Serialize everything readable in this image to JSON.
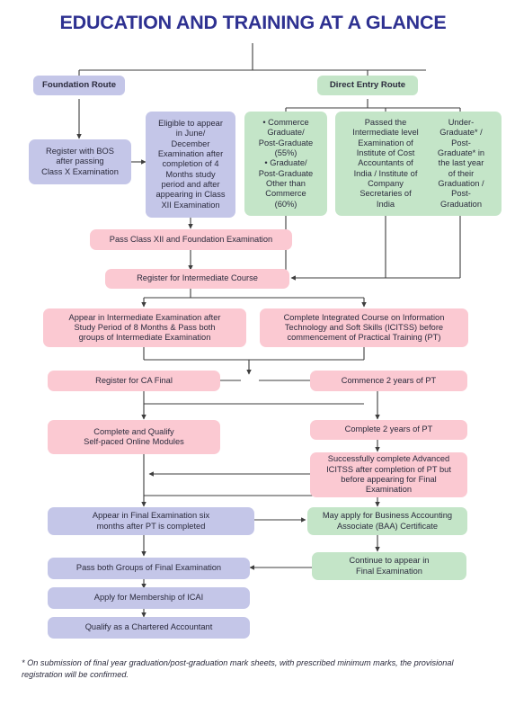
{
  "title": "EDUCATION AND TRAINING AT A GLANCE",
  "colors": {
    "title": "#2e3191",
    "purple": "#c4c6e8",
    "green": "#c4e5c8",
    "pink": "#fbc9d2",
    "connector": "#3d3d3d",
    "background": "#ffffff"
  },
  "routes": {
    "foundation": "Foundation Route",
    "direct_entry": "Direct Entry Route"
  },
  "nodes": {
    "register_bos": "Register with BOS\nafter passing\nClass X Examination",
    "eligible_june_dec": "Eligible to appear\nin June/\nDecember\nExamination after\ncompletion of 4\nMonths study\nperiod and after\nappearing in Class\nXII Examination",
    "commerce_graduate": "• Commerce\nGraduate/\nPost-Graduate\n(55%)\n• Graduate/\nPost-Graduate\nOther than\nCommerce\n(60%)",
    "passed_intermediate": "Passed the\nIntermediate level\nExamination of\nInstitute of Cost\nAccountants of\nIndia / Institute of\nCompany\nSecretaries of\nIndia",
    "under_graduate": "Under-\nGraduate* /\nPost-\nGraduate* in\nthe last year\nof their\nGraduation /\nPost-\nGraduation",
    "pass_class_xii": "Pass Class XII and Foundation Examination",
    "register_intermediate": "Register for Intermediate Course",
    "appear_intermediate": "Appear in Intermediate Examination after\nStudy Period of 8 Months & Pass both\ngroups of Intermediate Examination",
    "complete_icitss": "Complete Integrated Course on Information\nTechnology and Soft Skills (ICITSS) before\ncommencement of Practical Training (PT)",
    "register_ca_final": "Register for CA Final",
    "commence_pt": "Commence 2 years of PT",
    "complete_qualify_spom": "Complete and Qualify\nSelf-paced Online Modules",
    "complete_pt": "Complete 2 years of PT",
    "advanced_icitss": "Successfully complete Advanced\nICITSS after completion of PT but\nbefore appearing for Final\nExamination",
    "appear_final": "Appear in Final Examination six\nmonths after PT is completed",
    "baa_certificate": "May apply for Business Accounting\nAssociate (BAA) Certificate",
    "continue_appear_final": "Continue to appear in\nFinal Examination",
    "pass_both_groups": "Pass both Groups of Final Examination",
    "apply_membership": "Apply for Membership of ICAI",
    "qualify_ca": "Qualify as a Chartered Accountant"
  },
  "footnote": "* On submission of final year graduation/post-graduation mark sheets, with prescribed minimum marks, the provisional registration will be confirmed."
}
